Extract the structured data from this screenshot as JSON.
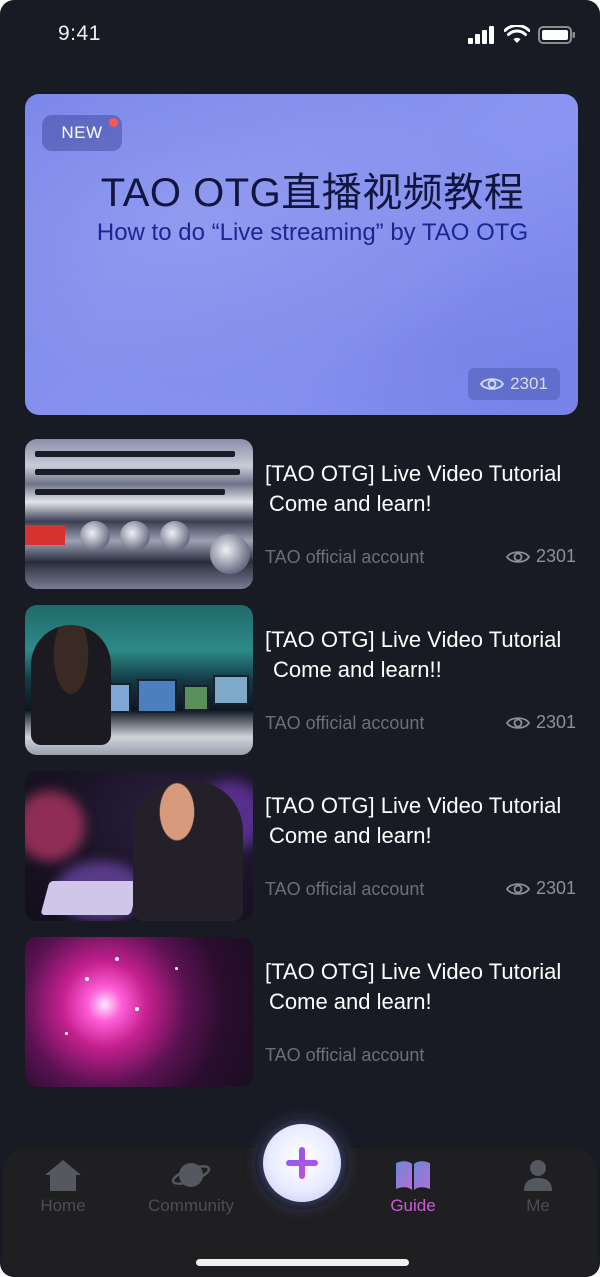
{
  "status_bar": {
    "time": "9:41"
  },
  "hero": {
    "badge": "NEW",
    "title": "TAO OTG直播视频教程",
    "subtitle": "How to do “Live streaming” by TAO OTG",
    "views": "2301",
    "colors": {
      "background": "#8590ee",
      "title": "#12153d",
      "subtitle": "#1c2690"
    }
  },
  "videos": [
    {
      "title_line1": "[TAO OTG] Live Video Tutorial",
      "title_line2": "Come and learn!",
      "author": "TAO official account",
      "views": "2301",
      "thumbnail": "audio-mixer-rack"
    },
    {
      "title_line1": "[TAO OTG] Live Video Tutorial",
      "title_line2": "Come and learn!!",
      "author": "TAO official account",
      "views": "2301",
      "thumbnail": "broadcast-control-room"
    },
    {
      "title_line1": "[TAO OTG] Live Video Tutorial",
      "title_line2": "Come and learn!",
      "author": "TAO official account",
      "views": "2301",
      "thumbnail": "man-with-laptop"
    },
    {
      "title_line1": "[TAO OTG] Live Video Tutorial",
      "title_line2": "Come and learn!",
      "author": "TAO official account",
      "thumbnail": "pink-light-burst"
    }
  ],
  "tab_bar": {
    "items": [
      {
        "label": "Home",
        "icon": "home-icon",
        "active": false
      },
      {
        "label": "Community",
        "icon": "planet-icon",
        "active": false
      },
      {
        "label": "Guide",
        "icon": "book-icon",
        "active": true
      },
      {
        "label": "Me",
        "icon": "person-icon",
        "active": false
      }
    ],
    "fab_icon": "plus-icon",
    "colors": {
      "active": "#c95ed4",
      "inactive": "#4b4e57"
    }
  },
  "colors": {
    "background": "#181b24",
    "text_primary": "#ffffff",
    "text_secondary": "#6b6f7c"
  }
}
